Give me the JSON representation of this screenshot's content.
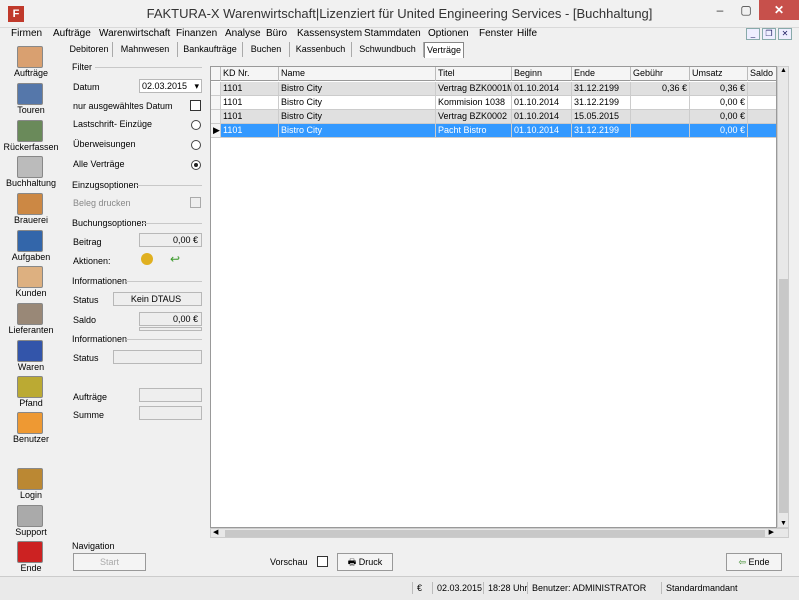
{
  "window": {
    "title": "FAKTURA-X Warenwirtschaft|Lizenziert für United Engineering Services - [Buchhaltung]",
    "app_icon_glyph": "F",
    "minimize_glyph": "–",
    "maximize_glyph": "▢",
    "close_glyph": "✕"
  },
  "menu": [
    "Firmen",
    "Aufträge",
    "Warenwirtschaft",
    "Finanzen",
    "Analyse",
    "Büro",
    "Kassensystem",
    "Stammdaten",
    "Optionen",
    "Fenster",
    "Hilfe"
  ],
  "mdi_buttons": {
    "minimize": "_",
    "restore": "❐",
    "close": "✕"
  },
  "sidebar": [
    {
      "label": "Aufträge",
      "icon": "orders-icon",
      "color": "#d9a070"
    },
    {
      "label": "Touren",
      "icon": "truck-icon",
      "color": "#5577aa"
    },
    {
      "label": "Rückerfassen",
      "icon": "return-truck-icon",
      "color": "#6a8a5a"
    },
    {
      "label": "Buchhaltung",
      "icon": "accounting-icon",
      "color": "#bbbbbb"
    },
    {
      "label": "Brauerei",
      "icon": "brewery-icon",
      "color": "#cc8844"
    },
    {
      "label": "Aufgaben",
      "icon": "tasks-icon",
      "color": "#3366aa"
    },
    {
      "label": "Kunden",
      "icon": "customers-icon",
      "color": "#ddb080"
    },
    {
      "label": "Lieferanten",
      "icon": "suppliers-icon",
      "color": "#998877"
    },
    {
      "label": "Waren",
      "icon": "goods-icon",
      "color": "#3355aa"
    },
    {
      "label": "Pfand",
      "icon": "deposit-icon",
      "color": "#bbaa33"
    },
    {
      "label": "Benutzer",
      "icon": "user-icon",
      "color": "#ee9933"
    },
    {
      "label": "Login",
      "icon": "key-icon",
      "color": "#bb8833"
    },
    {
      "label": "Support",
      "icon": "handshake-icon",
      "color": "#aaaaaa"
    },
    {
      "label": "Ende",
      "icon": "power-icon",
      "color": "#cc2222"
    }
  ],
  "tabs": [
    "Debitoren",
    "Mahnwesen",
    "Bankaufträge",
    "Buchen",
    "Kassenbuch",
    "Schwundbuch",
    "Verträge"
  ],
  "active_tab": "Verträge",
  "filter": {
    "title": "Filter",
    "datum_label": "Datum",
    "datum_value": "02.03.2015",
    "only_date_label": "nur ausgewähltes Datum",
    "radios": [
      {
        "label": "Lastschrift- Einzüge",
        "checked": false
      },
      {
        "label": "Überweisungen",
        "checked": false
      },
      {
        "label": "Alle Verträge",
        "checked": true
      }
    ]
  },
  "einzug": {
    "title": "Einzugsoptionen",
    "beleg_label": "Beleg drucken"
  },
  "buchung": {
    "title": "Buchungsoptionen",
    "beitrag_label": "Beitrag",
    "beitrag_value": "0,00 €",
    "aktionen_label": "Aktionen:"
  },
  "info1": {
    "title": "Informationen",
    "status_label": "Status",
    "status_value": "Kein DTAUS",
    "saldo_label": "Saldo",
    "saldo_value": "0,00 €"
  },
  "info2": {
    "title": "Informationen",
    "status_label": "Status",
    "auftraege_label": "Aufträge",
    "summe_label": "Summe"
  },
  "grid": {
    "columns": [
      {
        "label": "KD Nr."
      },
      {
        "label": "Name"
      },
      {
        "label": "Titel"
      },
      {
        "label": "Beginn"
      },
      {
        "label": "Ende"
      },
      {
        "label": "Gebühr"
      },
      {
        "label": "Umsatz"
      },
      {
        "label": "Saldo"
      }
    ],
    "rows": [
      {
        "kd": "1101",
        "name": "Bistro City",
        "titel": "Vertrag BZK0001M3",
        "beginn": "01.10.2014",
        "ende": "31.12.2199",
        "gebuehr": "0,36 €",
        "umsatz": "0,36 €",
        "saldo": "",
        "style": "gray"
      },
      {
        "kd": "1101",
        "name": "Bistro City",
        "titel": "Kommision 1038",
        "beginn": "01.10.2014",
        "ende": "31.12.2199",
        "gebuehr": "",
        "umsatz": "0,00 €",
        "saldo": "",
        "style": "white"
      },
      {
        "kd": "1101",
        "name": "Bistro City",
        "titel": "Vertrag BZK0002",
        "beginn": "01.10.2014",
        "ende": "15.05.2015",
        "gebuehr": "",
        "umsatz": "0,00 €",
        "saldo": "",
        "style": "gray"
      },
      {
        "kd": "1101",
        "name": "Bistro City",
        "titel": "Pacht Bistro",
        "beginn": "01.10.2014",
        "ende": "31.12.2199",
        "gebuehr": "",
        "umsatz": "0,00 €",
        "saldo": "",
        "style": "sel"
      }
    ],
    "row_marker": "▶"
  },
  "bottom": {
    "navigation_label": "Navigation",
    "start_label": "Start",
    "vorschau_label": "Vorschau",
    "druck_label": "Druck",
    "ende_label": "Ende"
  },
  "statusbar": {
    "currency": "€",
    "date": "02.03.2015",
    "time": "18:28 Uhr",
    "user": "Benutzer: ADMINISTRATOR",
    "mandant": "Standardmandant"
  }
}
